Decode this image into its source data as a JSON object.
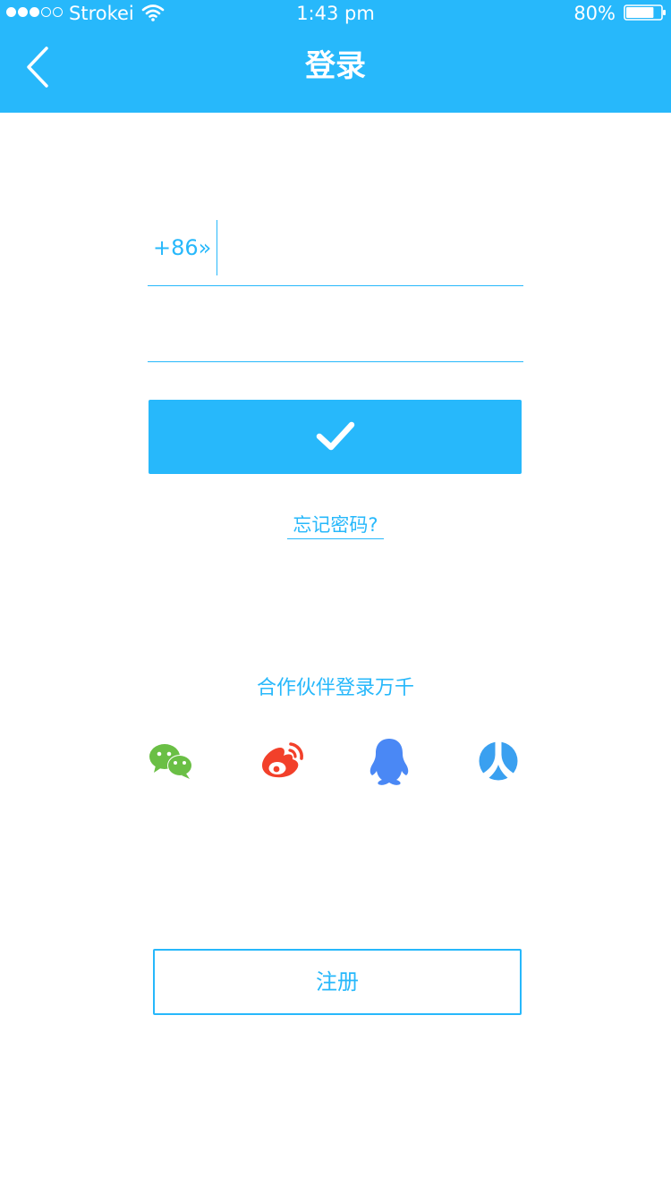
{
  "status_bar": {
    "carrier": "Strokei",
    "time": "1:43 pm",
    "battery": "80%",
    "battery_level": 0.8,
    "signal_bars": 3,
    "signal_total": 5
  },
  "header": {
    "title": "登录",
    "back_icon": "chevron-left-icon",
    "background_color": "#27b8fb"
  },
  "form": {
    "country_code": "+86»",
    "phone_value": "",
    "password_value": "",
    "submit_icon": "checkmark-icon",
    "forgot_password": "忘记密码?"
  },
  "partners": {
    "label": "合作伙伴登录万千",
    "items": [
      {
        "name": "wechat",
        "icon": "wechat-icon",
        "color": "#6abf45"
      },
      {
        "name": "weibo",
        "icon": "weibo-icon",
        "color": "#f2402a"
      },
      {
        "name": "qq",
        "icon": "qq-icon",
        "color": "#4a88f5"
      },
      {
        "name": "renren",
        "icon": "renren-icon",
        "color": "#3aa0f0"
      }
    ]
  },
  "register": {
    "label": "注册"
  },
  "colors": {
    "accent": "#27b8fb",
    "background": "#ffffff"
  }
}
